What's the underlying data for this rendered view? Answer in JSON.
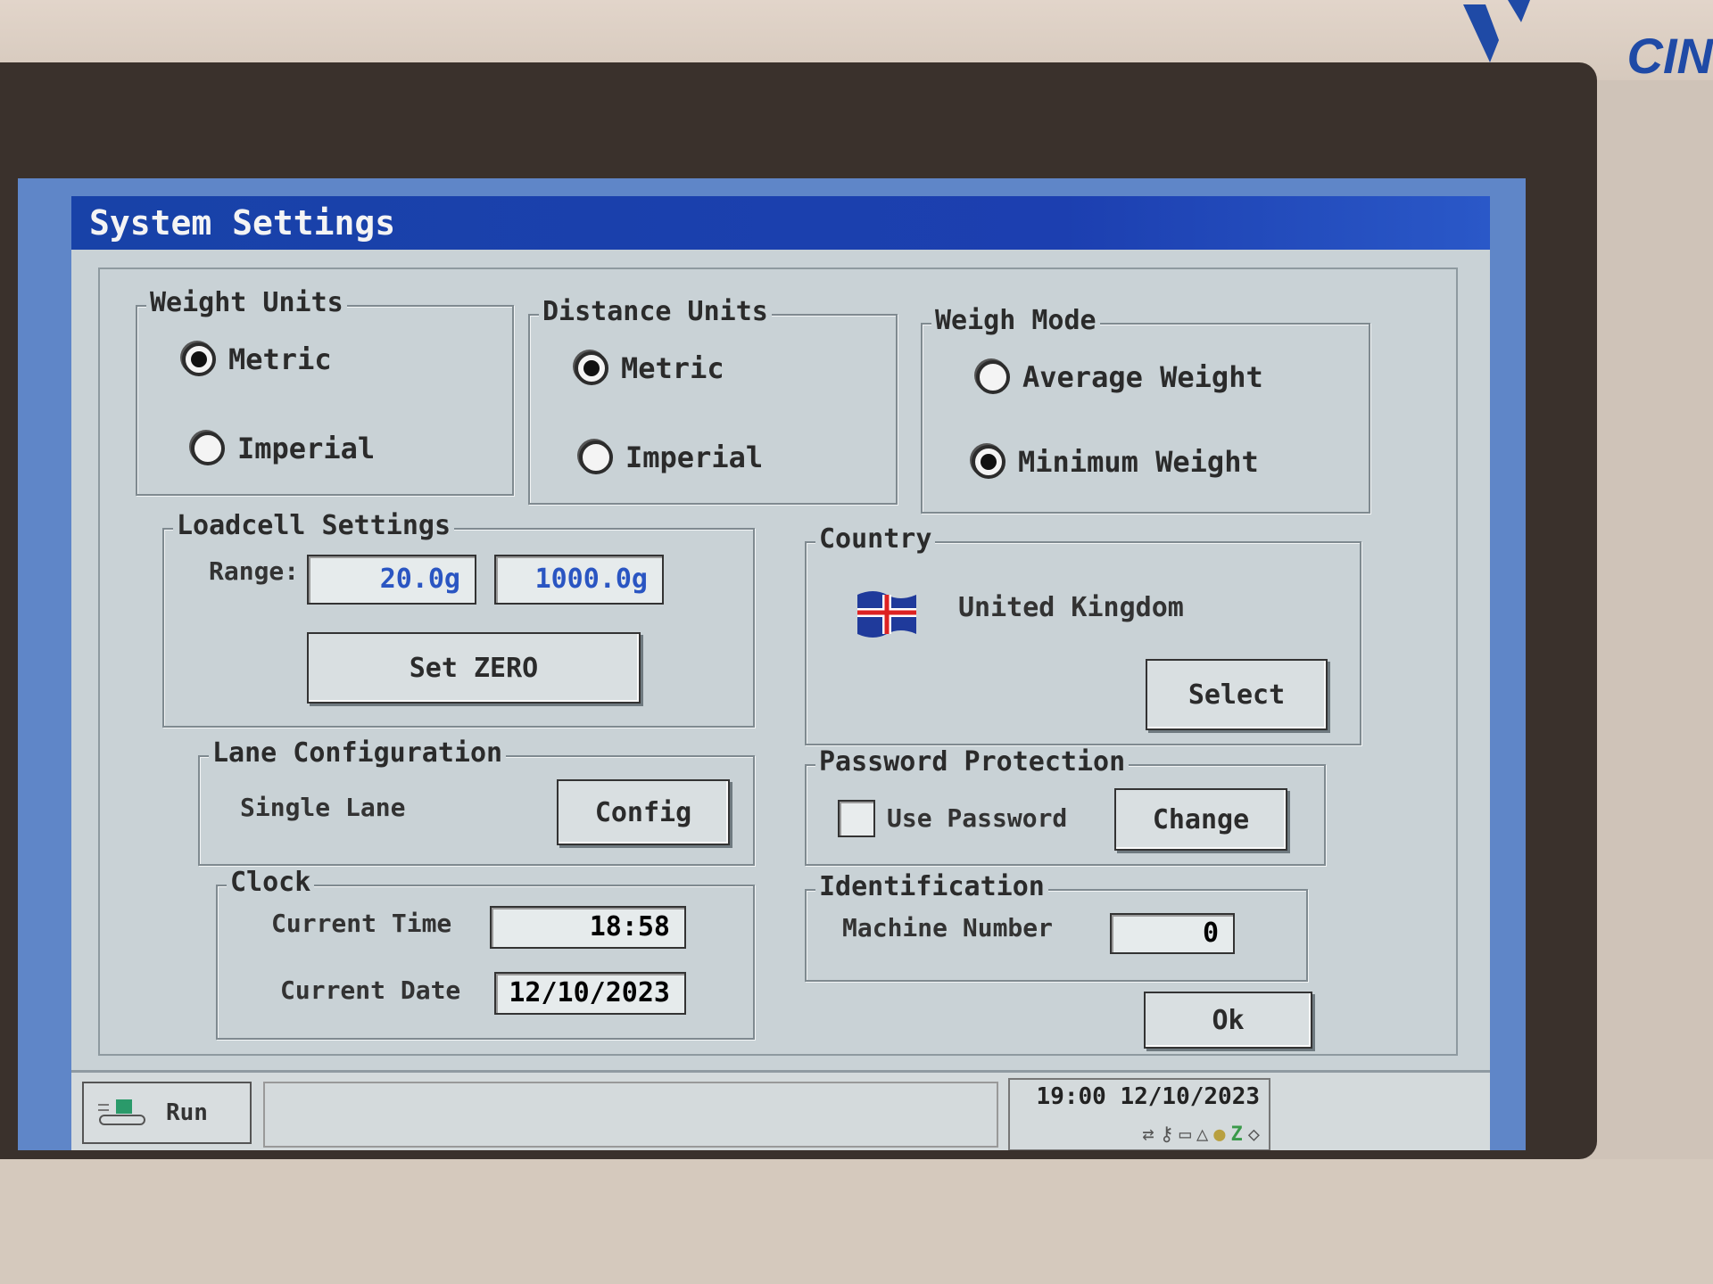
{
  "brand": {
    "logo_text": "CIN",
    "color": "#1f4aa6"
  },
  "window": {
    "title": "System Settings"
  },
  "weight_units": {
    "title": "Weight Units",
    "options": [
      {
        "label": "Metric",
        "selected": true
      },
      {
        "label": "Imperial",
        "selected": false
      }
    ]
  },
  "distance_units": {
    "title": "Distance Units",
    "options": [
      {
        "label": "Metric",
        "selected": true
      },
      {
        "label": "Imperial",
        "selected": false
      }
    ]
  },
  "weigh_mode": {
    "title": "Weigh Mode",
    "options": [
      {
        "label": "Average Weight",
        "selected": false
      },
      {
        "label": "Minimum Weight",
        "selected": true
      }
    ]
  },
  "loadcell": {
    "title": "Loadcell Settings",
    "range_label": "Range:",
    "range_min": "20.0g",
    "range_max": "1000.0g",
    "set_zero_label": "Set ZERO"
  },
  "country": {
    "title": "Country",
    "name": "United Kingdom",
    "flag_icon": "uk-flag-icon",
    "select_label": "Select"
  },
  "lane": {
    "title": "Lane Configuration",
    "value": "Single Lane",
    "config_label": "Config"
  },
  "password": {
    "title": "Password Protection",
    "use_password_label": "Use Password",
    "use_password_checked": false,
    "change_label": "Change"
  },
  "clock": {
    "title": "Clock",
    "time_label": "Current Time",
    "time_value": "18:58",
    "date_label": "Current Date",
    "date_value": "12/10/2023"
  },
  "identification": {
    "title": "Identification",
    "machine_label": "Machine Number",
    "machine_value": "0"
  },
  "ok_label": "Ok",
  "taskbar": {
    "run_label": "Run",
    "run_icon": "conveyor-icon",
    "status_datetime": "19:00 12/10/2023",
    "status_icons": [
      "network-icon",
      "key-icon",
      "computer-icon",
      "weight-icon",
      "bulb-icon",
      "zero-icon",
      "box-icon"
    ]
  }
}
